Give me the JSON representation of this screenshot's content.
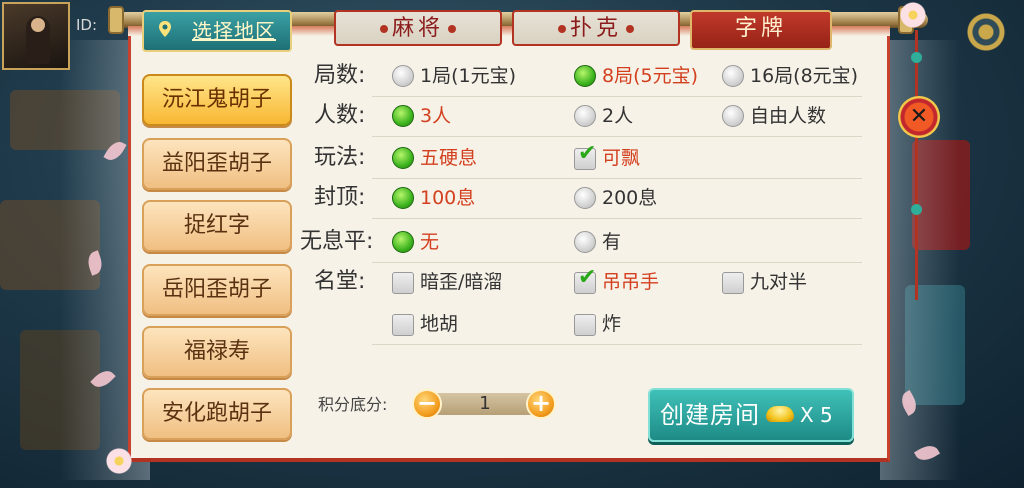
{
  "header": {
    "id_label": "ID:",
    "region_tab": "选择地区",
    "tabs": [
      {
        "label": "麻将",
        "active": false
      },
      {
        "label": "扑克",
        "active": false
      },
      {
        "label": "字牌",
        "active": true
      }
    ]
  },
  "menu": {
    "items": [
      {
        "label": "沅江鬼胡子",
        "active": true
      },
      {
        "label": "益阳歪胡子",
        "active": false
      },
      {
        "label": "捉红字",
        "active": false
      },
      {
        "label": "岳阳歪胡子",
        "active": false
      },
      {
        "label": "福禄寿",
        "active": false
      },
      {
        "label": "安化跑胡子",
        "active": false
      }
    ]
  },
  "options": {
    "rounds": {
      "label": "局数:",
      "choices": [
        {
          "text": "1局(1元宝)",
          "selected": false
        },
        {
          "text": "8局(5元宝)",
          "selected": true
        },
        {
          "text": "16局(8元宝)",
          "selected": false
        }
      ]
    },
    "players": {
      "label": "人数:",
      "choices": [
        {
          "text": "3人",
          "selected": true
        },
        {
          "text": "2人",
          "selected": false
        },
        {
          "text": "自由人数",
          "selected": false
        }
      ]
    },
    "play": {
      "label": "玩法:",
      "choices": [
        {
          "text": "五硬息",
          "selected": true,
          "type": "radio"
        },
        {
          "text": "可飘",
          "selected": true,
          "type": "check"
        }
      ]
    },
    "cap": {
      "label": "封顶:",
      "choices": [
        {
          "text": "100息",
          "selected": true
        },
        {
          "text": "200息",
          "selected": false
        }
      ]
    },
    "no_xi": {
      "label": "无息平:",
      "choices": [
        {
          "text": "无",
          "selected": true
        },
        {
          "text": "有",
          "selected": false
        }
      ]
    },
    "hall": {
      "label": "名堂:",
      "choices": [
        {
          "text": "暗歪/暗溜",
          "selected": false
        },
        {
          "text": "吊吊手",
          "selected": true
        },
        {
          "text": "九对半",
          "selected": false
        },
        {
          "text": "地胡",
          "selected": false
        },
        {
          "text": "炸",
          "selected": false
        }
      ]
    }
  },
  "score": {
    "label": "积分底分:",
    "value": "1",
    "minus": "−",
    "plus": "+"
  },
  "create": {
    "label": "创建房间",
    "cost": "X 5"
  },
  "close": {
    "glyph": "✕"
  },
  "colors": {
    "accent_red": "#c8402e",
    "selected_text": "#d3401f",
    "create_teal": "#1e8b86"
  }
}
